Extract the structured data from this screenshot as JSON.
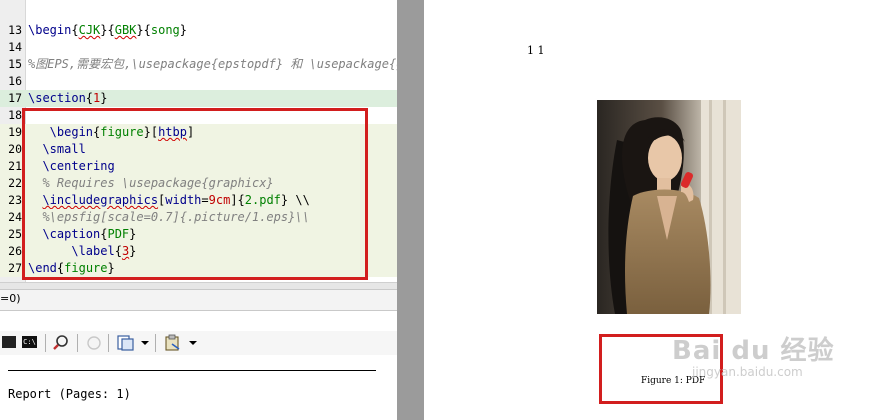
{
  "editor": {
    "lines": [
      {
        "num": "13",
        "segments": [
          [
            "\\begin",
            "kw"
          ],
          [
            "{",
            "br"
          ],
          [
            "CJK",
            "arg sq"
          ],
          [
            "}{",
            "br"
          ],
          [
            "GBK",
            "arg sq"
          ],
          [
            "}{",
            "br"
          ],
          [
            "song",
            "arg"
          ],
          [
            "}",
            "br"
          ]
        ]
      },
      {
        "num": "14",
        "segments": []
      },
      {
        "num": "15",
        "segments": [
          [
            "%图EPS,需要宏包,\\usepackage{epstopdf} 和 \\usepackage{graphicx}",
            "cm"
          ]
        ]
      },
      {
        "num": "16",
        "segments": []
      },
      {
        "num": "17",
        "segments": [
          [
            "\\section",
            "kw"
          ],
          [
            "{",
            "br"
          ],
          [
            "1",
            "num"
          ],
          [
            "}",
            "br"
          ]
        ]
      },
      {
        "num": "18",
        "segments": []
      },
      {
        "num": "19",
        "segments": [
          [
            "   \\begin",
            "kw"
          ],
          [
            "{",
            "br"
          ],
          [
            "figure",
            "arg"
          ],
          [
            "}[",
            "br"
          ],
          [
            "htbp",
            "kw sq"
          ],
          [
            "]",
            "br"
          ]
        ]
      },
      {
        "num": "20",
        "segments": [
          [
            "  \\small",
            "kw"
          ]
        ]
      },
      {
        "num": "21",
        "segments": [
          [
            "  \\centering",
            "kw"
          ]
        ]
      },
      {
        "num": "22",
        "segments": [
          [
            "  % Requires \\usepackage{graphicx}",
            "cm"
          ]
        ]
      },
      {
        "num": "23",
        "segments": [
          [
            "  ",
            "br"
          ],
          [
            "\\includegraphics",
            "kw sq"
          ],
          [
            "[",
            "br"
          ],
          [
            "width",
            "kw"
          ],
          [
            "=",
            "br"
          ],
          [
            "9cm",
            "num"
          ],
          [
            "]{",
            "br"
          ],
          [
            "2.pdf",
            "arg"
          ],
          [
            "} \\\\",
            "br"
          ]
        ]
      },
      {
        "num": "24",
        "segments": [
          [
            "  %\\epsfig[scale=0.7]{.picture/1.eps}\\\\",
            "cm"
          ]
        ]
      },
      {
        "num": "25",
        "segments": [
          [
            "  \\caption",
            "kw"
          ],
          [
            "{",
            "br"
          ],
          [
            "PDF",
            "arg"
          ],
          [
            "}",
            "br"
          ]
        ]
      },
      {
        "num": "26",
        "segments": [
          [
            "      \\label",
            "kw"
          ],
          [
            "{",
            "br"
          ],
          [
            "3",
            "num sq"
          ],
          [
            "}",
            "br"
          ]
        ]
      },
      {
        "num": "27",
        "segments": [
          [
            "\\end",
            "kw"
          ],
          [
            "{",
            "br"
          ],
          [
            "figure",
            "arg"
          ],
          [
            "}",
            "br"
          ]
        ]
      }
    ]
  },
  "status": {
    "text": "=0)"
  },
  "toolbar": {
    "icons": [
      "terminal-icon",
      "console-icon",
      "search-icon",
      "circle-icon",
      "document-icon",
      "dropdown-icon",
      "clipboard-icon",
      "dropdown-icon"
    ]
  },
  "report": {
    "text": "Report (Pages: 1)"
  },
  "viewer": {
    "page_header": "1   1",
    "figure_caption": "Figure 1: PDF"
  },
  "watermark": {
    "main": "Bai du 经验",
    "sub": "jingyan.baidu.com"
  },
  "colors": {
    "highlight_box": "#d21e1e",
    "divider": "#9b9b9b",
    "section_highlight": "#dceedd"
  }
}
